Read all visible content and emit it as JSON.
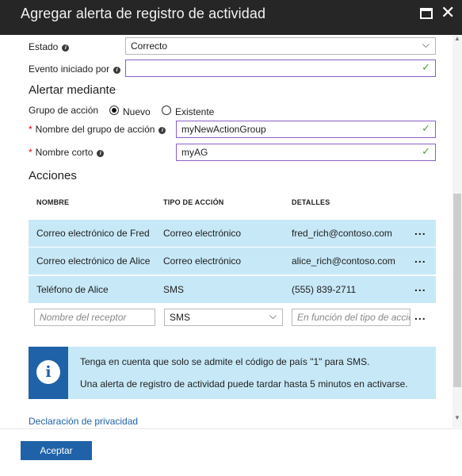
{
  "window": {
    "title": "Agregar alerta de registro de actividad"
  },
  "fields": {
    "estado": {
      "label": "Estado",
      "value": "Correcto"
    },
    "evento": {
      "label": "Evento iniciado por",
      "value": ""
    }
  },
  "alertar": {
    "heading": "Alertar mediante",
    "grupo_label": "Grupo de acción",
    "opt_nuevo": "Nuevo",
    "opt_existente": "Existente",
    "nombre_grupo_label": "Nombre del grupo de acción",
    "nombre_grupo_value": "myNewActionGroup",
    "nombre_corto_label": "Nombre corto",
    "nombre_corto_value": "myAG"
  },
  "acciones": {
    "heading": "Acciones",
    "columns": [
      "NOMBRE",
      "TIPO DE ACCIÓN",
      "DETALLES"
    ],
    "rows": [
      {
        "nombre": "Correo electrónico de Fred",
        "tipo": "Correo electrónico",
        "detalles": "fred_rich@contoso.com"
      },
      {
        "nombre": "Correo electrónico de Alice",
        "tipo": "Correo electrónico",
        "detalles": "alice_rich@contoso.com"
      },
      {
        "nombre": "Teléfono de Alice",
        "tipo": "SMS",
        "detalles": "(555) 839-2711"
      }
    ],
    "new_row": {
      "name_placeholder": "Nombre del receptor",
      "type_value": "SMS",
      "details_placeholder": "En función del tipo de acción"
    },
    "more_label": "..."
  },
  "notice": {
    "line1": "Tenga en cuenta que solo se admite el código de país \"1\" para SMS.",
    "line2": "Una alerta de registro de actividad puede tardar hasta 5 minutos en activarse."
  },
  "privacy_link": "Declaración de privacidad",
  "ok_button": "Aceptar",
  "info_glyph": "i",
  "check_glyph": "✓",
  "chevron_glyph": "⌄"
}
